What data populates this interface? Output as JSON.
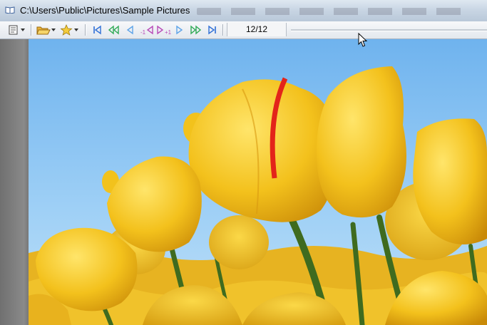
{
  "window": {
    "title": "C:\\Users\\Public\\Pictures\\Sample Pictures"
  },
  "toolbar": {
    "buttons": [
      {
        "name": "view-menu-button",
        "icon": "view-icon"
      },
      {
        "name": "open-folder-button",
        "icon": "folder-icon"
      },
      {
        "name": "favorites-button",
        "icon": "star-icon"
      },
      {
        "name": "first-image-button",
        "icon": "skip-first-icon"
      },
      {
        "name": "fast-back-button",
        "icon": "rewind-icon"
      },
      {
        "name": "previous-button",
        "icon": "prev-icon"
      },
      {
        "name": "back-one-button",
        "icon": "back-one-icon"
      },
      {
        "name": "forward-one-button",
        "icon": "forward-one-icon"
      },
      {
        "name": "next-button",
        "icon": "next-icon"
      },
      {
        "name": "fast-forward-button",
        "icon": "fast-forward-icon"
      },
      {
        "name": "last-image-button",
        "icon": "skip-last-icon"
      }
    ],
    "counter": "12/12",
    "back_one_label": "-1",
    "forward_one_label": "+1"
  },
  "colors": {
    "accent_nav": "#2f6fd6",
    "accent_nav_light": "#5ea4e8",
    "special_nav": "#b84ab8",
    "sky": "#7fbef0",
    "tulip": "#f2c21c"
  }
}
